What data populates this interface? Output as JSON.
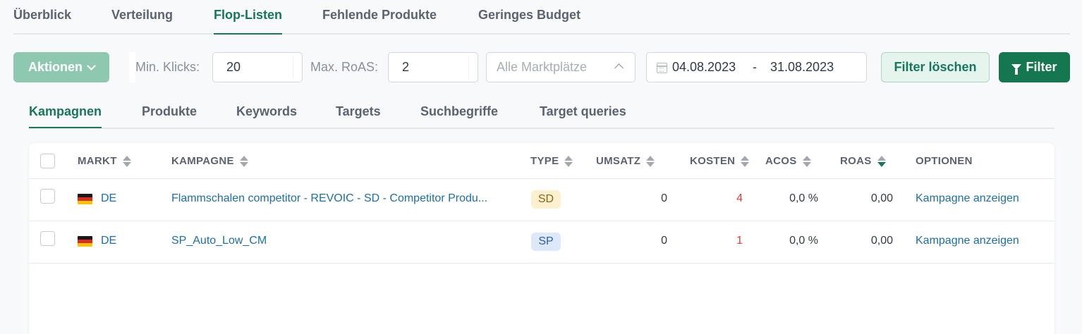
{
  "top_tabs": [
    "Überblick",
    "Verteilung",
    "Flop-Listen",
    "Fehlende Produkte",
    "Geringes Budget"
  ],
  "active_top_tab": "Flop-Listen",
  "filters": {
    "actions_label": "Aktionen",
    "min_clicks_label": "Min. Klicks:",
    "min_clicks_value": "20",
    "max_roas_label": "Max. RoAS:",
    "max_roas_value": "2",
    "market_placeholder": "Alle Marktplätze",
    "date_start": "04.08.2023",
    "date_sep": "-",
    "date_end": "31.08.2023",
    "clear_label": "Filter löschen",
    "filter_label": "Filter"
  },
  "sub_tabs": [
    "Kampagnen",
    "Produkte",
    "Keywords",
    "Targets",
    "Suchbegriffe",
    "Target queries"
  ],
  "active_sub_tab": "Kampagnen",
  "table": {
    "columns": {
      "market": "MARKT",
      "campaign": "KAMPAGNE",
      "type": "TYPE",
      "revenue": "UMSATZ",
      "cost": "KOSTEN",
      "acos": "ACOS",
      "roas": "ROAS",
      "options": "OPTIONEN"
    },
    "sort_column": "roas",
    "rows": [
      {
        "market": "DE",
        "campaign": "Flammschalen competitor - REVOIC - SD - Competitor Produ...",
        "type": "SD",
        "revenue": "0",
        "cost": "4",
        "acos": "0,0 %",
        "roas": "0,00",
        "option": "Kampagne anzeigen"
      },
      {
        "market": "DE",
        "campaign": "SP_Auto_Low_CM",
        "type": "SP",
        "revenue": "0",
        "cost": "1",
        "acos": "0,0 %",
        "roas": "0,00",
        "option": "Kampagne anzeigen"
      }
    ]
  },
  "colors": {
    "accent": "#16775a",
    "sd_badge_bg": "#fcf0cf",
    "sd_badge_text": "#8a6516",
    "sp_badge_bg": "#dde8fb",
    "sp_badge_text": "#2b5fae",
    "cost_text": "#d9403a",
    "link": "#1d6fa5"
  }
}
